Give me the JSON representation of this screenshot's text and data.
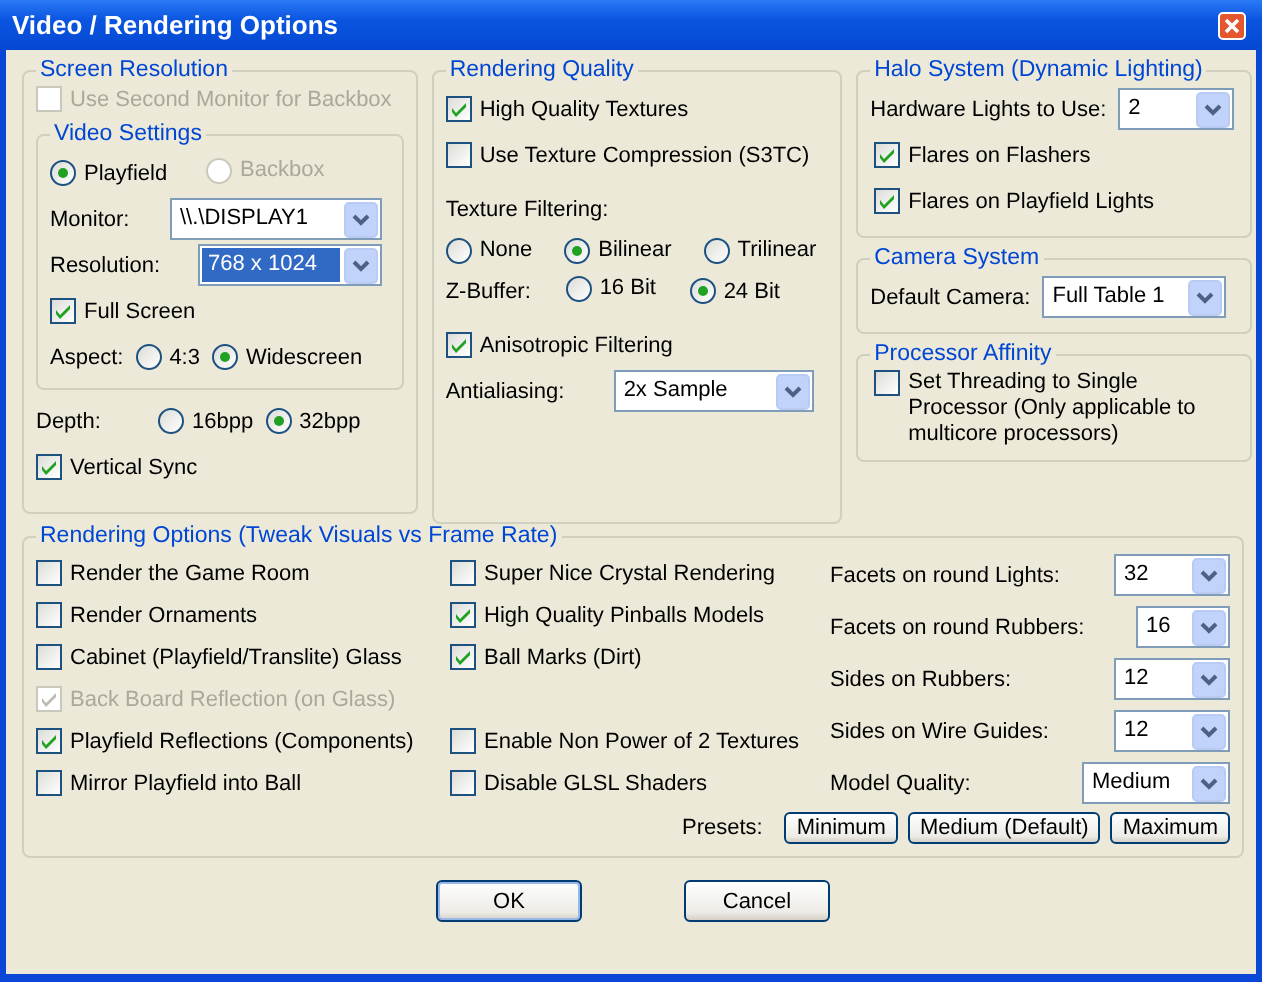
{
  "window": {
    "title": "Video / Rendering Options"
  },
  "screen_resolution": {
    "title": "Screen Resolution",
    "second_monitor": {
      "label": "Use Second Monitor for Backbox",
      "checked": false,
      "disabled": true
    },
    "video_settings": {
      "title": "Video Settings",
      "target": [
        {
          "label": "Playfield",
          "selected": true,
          "disabled": false
        },
        {
          "label": "Backbox",
          "selected": false,
          "disabled": true
        }
      ],
      "monitor": {
        "label": "Monitor:",
        "value": "\\\\.\\DISPLAY1",
        "focused": false
      },
      "resolution": {
        "label": "Resolution:",
        "value": "768 x 1024",
        "focused": true
      },
      "full_screen": {
        "label": "Full Screen",
        "checked": true,
        "disabled": false
      },
      "aspect": {
        "label": "Aspect:",
        "options": [
          {
            "label": "4:3",
            "selected": false
          },
          {
            "label": "Widescreen",
            "selected": true
          }
        ]
      }
    },
    "depth": {
      "label": "Depth:",
      "options": [
        {
          "label": "16bpp",
          "selected": false
        },
        {
          "label": "32bpp",
          "selected": true
        }
      ]
    },
    "vertical_sync": {
      "label": "Vertical Sync",
      "checked": true,
      "disabled": false
    }
  },
  "rendering_quality": {
    "title": "Rendering Quality",
    "high_quality_textures": {
      "label": "High Quality Textures",
      "checked": true,
      "disabled": false
    },
    "texture_compression": {
      "label": "Use Texture Compression (S3TC)",
      "checked": false,
      "disabled": false
    },
    "texture_filtering": {
      "label": "Texture Filtering:",
      "options": [
        {
          "label": "None",
          "selected": false
        },
        {
          "label": "Bilinear",
          "selected": true
        },
        {
          "label": "Trilinear",
          "selected": false
        }
      ]
    },
    "z_buffer": {
      "label": "Z-Buffer:",
      "options": [
        {
          "label": "16 Bit",
          "selected": false
        },
        {
          "label": "24 Bit",
          "selected": true
        }
      ]
    },
    "anisotropic": {
      "label": "Anisotropic Filtering",
      "checked": true,
      "disabled": false
    },
    "antialiasing": {
      "label": "Antialiasing:",
      "value": "2x Sample",
      "focused": false
    }
  },
  "halo_system": {
    "title": "Halo System (Dynamic Lighting)",
    "hardware_lights": {
      "label": "Hardware Lights to Use:",
      "value": "2",
      "focused": false
    },
    "flares_flashers": {
      "label": "Flares on Flashers",
      "checked": true,
      "disabled": false
    },
    "flares_lights": {
      "label": "Flares on Playfield Lights",
      "checked": true,
      "disabled": false
    }
  },
  "camera_system": {
    "title": "Camera System",
    "default_camera": {
      "label": "Default Camera:",
      "value": "Full Table 1",
      "focused": false
    }
  },
  "processor_affinity": {
    "title": "Processor Affinity",
    "single_processor": {
      "label": "Set Threading to Single Processor (Only applicable to multicore processors)",
      "checked": false,
      "disabled": false
    }
  },
  "rendering_options": {
    "title": "Rendering Options (Tweak Visuals vs Frame Rate)",
    "left_options": [
      {
        "label": "Render the Game Room",
        "checked": false,
        "disabled": false
      },
      {
        "label": "Render Ornaments",
        "checked": false,
        "disabled": false
      },
      {
        "label": "Cabinet (Playfield/Translite) Glass",
        "checked": false,
        "disabled": false
      },
      {
        "label": "Back Board Reflection (on Glass)",
        "checked": true,
        "disabled": true
      },
      {
        "label": "Playfield Reflections (Components)",
        "checked": true,
        "disabled": false
      },
      {
        "label": "Mirror Playfield into Ball",
        "checked": false,
        "disabled": false
      }
    ],
    "middle_options": [
      {
        "label": "Super Nice Crystal Rendering",
        "checked": false,
        "disabled": false
      },
      {
        "label": "High Quality Pinballs Models",
        "checked": true,
        "disabled": false
      },
      {
        "label": "Ball Marks (Dirt)",
        "checked": true,
        "disabled": false
      },
      {
        "label": "Enable Non Power of 2 Textures",
        "checked": false,
        "disabled": false
      },
      {
        "label": "Disable GLSL Shaders",
        "checked": false,
        "disabled": false
      }
    ],
    "detail_settings": [
      {
        "label": "Facets on round Lights:",
        "value": "32",
        "focused": false
      },
      {
        "label": "Facets on round Rubbers:",
        "value": "16",
        "focused": false
      },
      {
        "label": "Sides on Rubbers:",
        "value": "12",
        "focused": false
      },
      {
        "label": "Sides on Wire Guides:",
        "value": "12",
        "focused": false
      },
      {
        "label": "Model Quality:",
        "value": "Medium",
        "focused": false
      }
    ],
    "presets": {
      "label": "Presets:",
      "buttons": [
        "Minimum",
        "Medium (Default)",
        "Maximum"
      ]
    }
  },
  "buttons": [
    "OK",
    "Cancel"
  ]
}
